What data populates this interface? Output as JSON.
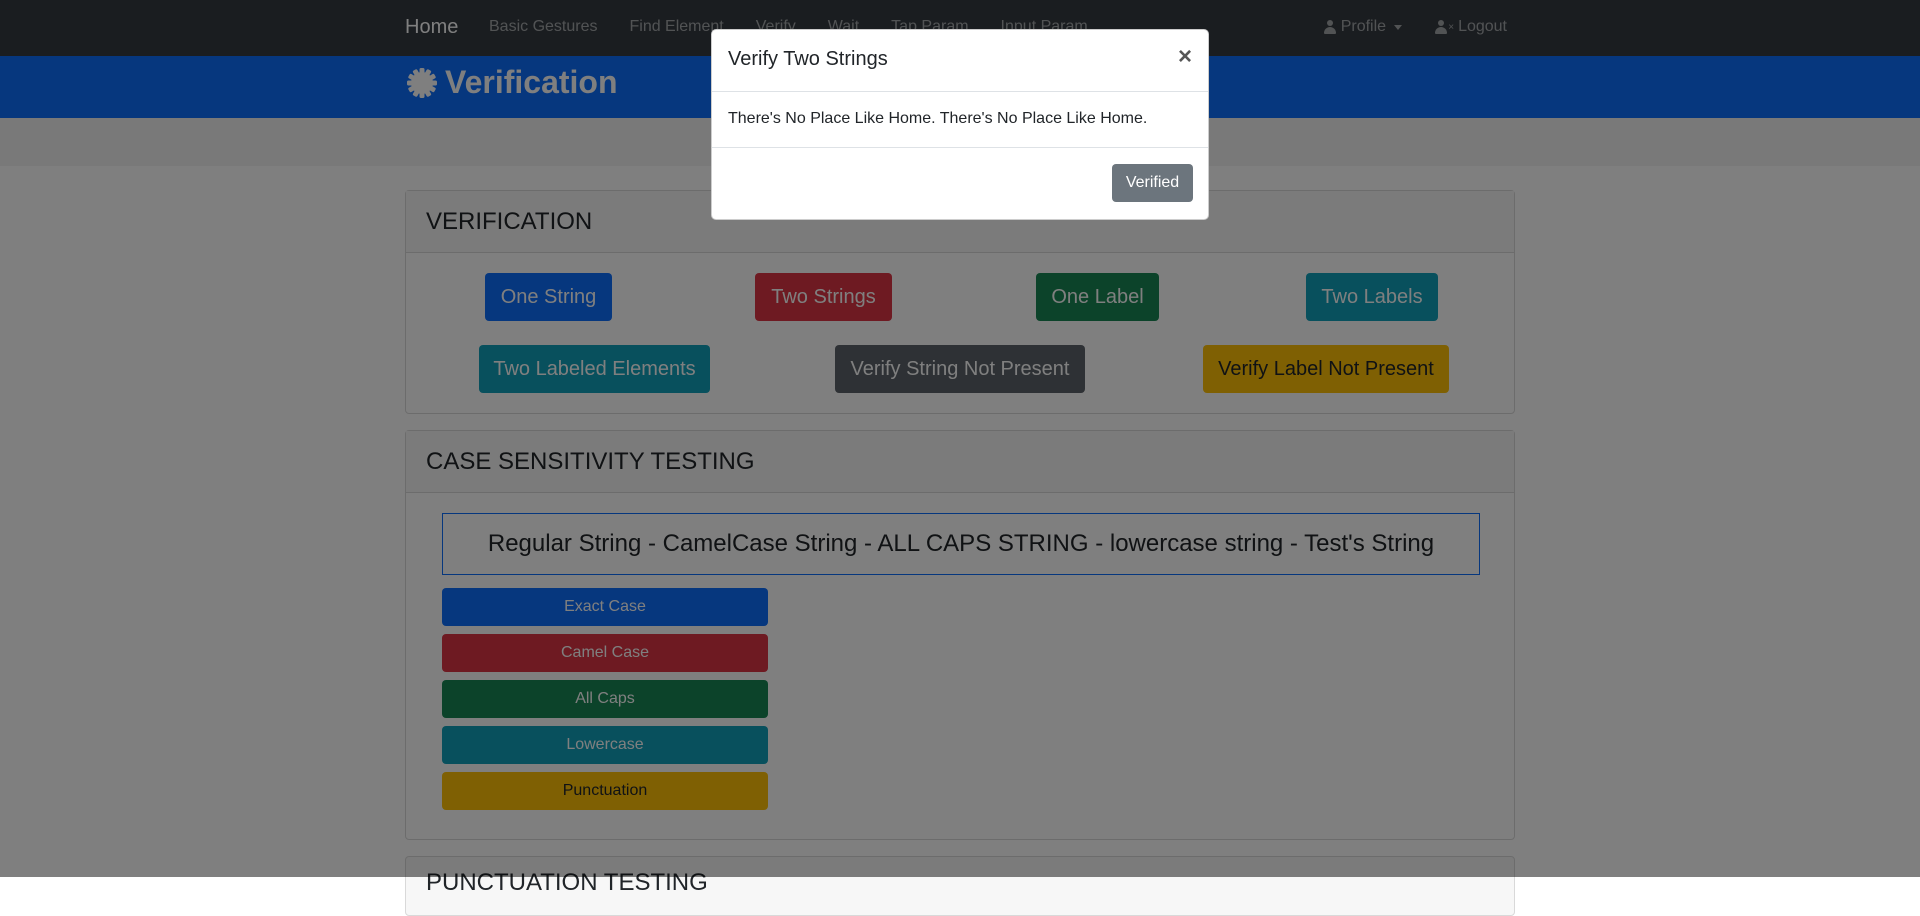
{
  "navbar": {
    "brand": "Home",
    "links": [
      "Basic Gestures",
      "Find Element",
      "Verify",
      "Wait",
      "Tap Param",
      "Input Param"
    ],
    "profile": "Profile",
    "logout": "Logout"
  },
  "header": {
    "title": "Verification",
    "icon": "gear-icon"
  },
  "verification": {
    "title": "VERIFICATION",
    "buttons": [
      "One String",
      "Two Strings",
      "One Label",
      "Two Labels",
      "Two Labeled Elements",
      "Verify String Not Present",
      "Verify Label Not Present"
    ]
  },
  "case_sensitivity": {
    "title": "CASE SENSITIVITY TESTING",
    "string": "Regular String - CamelCase String - ALL CAPS STRING - lowercase string - Test's String",
    "buttons": [
      "Exact Case",
      "Camel Case",
      "All Caps",
      "Lowercase",
      "Punctuation"
    ]
  },
  "punctuation": {
    "title": "PUNCTUATION TESTING"
  },
  "modal": {
    "title": "Verify Two Strings",
    "close": "×",
    "body": "There's No Place Like Home. There's No Place Like Home.",
    "button": "Verified"
  },
  "colors": {
    "primary": "#0d6efd",
    "danger": "#dc3545",
    "success": "#198754",
    "info": "#11a1ba",
    "dark": "#5c636a",
    "warning": "#ffc107",
    "navbar": "#343a40"
  }
}
